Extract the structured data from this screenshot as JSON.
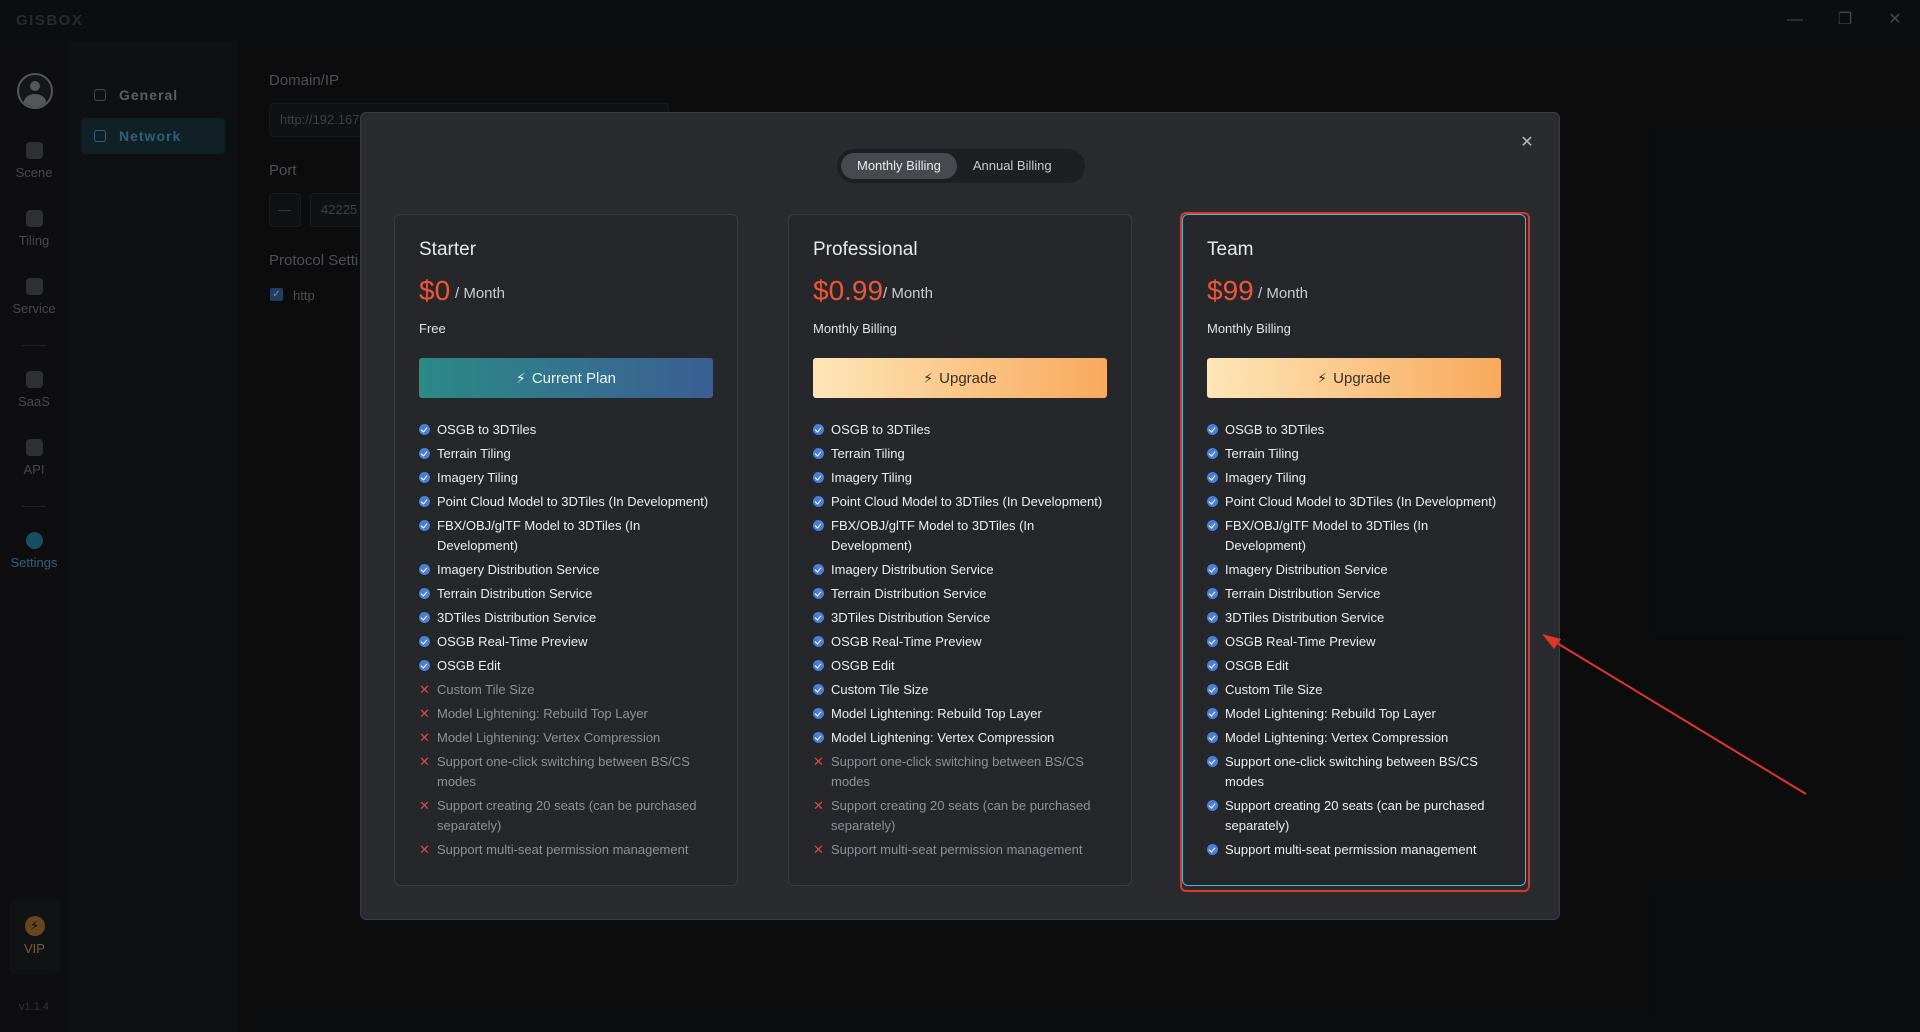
{
  "app": {
    "logo": "GISBOX",
    "version": "v1.1.4"
  },
  "window": {
    "min": "—",
    "restore": "❐",
    "close": "✕"
  },
  "rail": {
    "items": [
      {
        "label": "Scene",
        "icon": "scene-icon"
      },
      {
        "label": "Tiling",
        "icon": "tiling-icon"
      },
      {
        "label": "Service",
        "icon": "service-icon"
      },
      {
        "label": "SaaS",
        "icon": "saas-icon"
      },
      {
        "label": "API",
        "icon": "api-icon"
      },
      {
        "label": "Settings",
        "icon": "settings-icon"
      }
    ],
    "vip": {
      "label": "VIP",
      "icon": "⚡"
    }
  },
  "submenu": {
    "items": [
      {
        "label": "General"
      },
      {
        "label": "Network"
      }
    ]
  },
  "form": {
    "domain_label": "Domain/IP",
    "domain_value": "http://192.167.",
    "port_label": "Port",
    "port_minus": "—",
    "port_value": "42225",
    "protocol_label": "Protocol Setti",
    "protocol_option": "http"
  },
  "dialog": {
    "close": "✕",
    "billing_options": [
      "Monthly Billing",
      "Annual Billing"
    ],
    "plans": [
      {
        "name": "Starter",
        "price": "$0",
        "period": "/ Month",
        "billing": "Free",
        "button": "Current Plan",
        "features": [
          {
            "text": "OSGB to 3DTiles",
            "included": true
          },
          {
            "text": "Terrain Tiling",
            "included": true
          },
          {
            "text": "Imagery Tiling",
            "included": true
          },
          {
            "text": "Point Cloud Model to 3DTiles (In Development)",
            "included": true
          },
          {
            "text": "FBX/OBJ/glTF Model to 3DTiles (In Development)",
            "included": true
          },
          {
            "text": "Imagery Distribution Service",
            "included": true
          },
          {
            "text": "Terrain Distribution Service",
            "included": true
          },
          {
            "text": "3DTiles Distribution Service",
            "included": true
          },
          {
            "text": "OSGB Real-Time Preview",
            "included": true
          },
          {
            "text": "OSGB Edit",
            "included": true
          },
          {
            "text": "Custom Tile Size",
            "included": false
          },
          {
            "text": "Model Lightening: Rebuild Top Layer",
            "included": false
          },
          {
            "text": "Model Lightening: Vertex Compression",
            "included": false
          },
          {
            "text": "Support one-click switching between BS/CS modes",
            "included": false
          },
          {
            "text": "Support creating 20 seats (can be purchased separately)",
            "included": false
          },
          {
            "text": "Support multi-seat permission management",
            "included": false
          }
        ]
      },
      {
        "name": "Professional",
        "price": "$0.99",
        "period": "/ Month",
        "billing": "Monthly Billing",
        "button": "Upgrade",
        "features": [
          {
            "text": "OSGB to 3DTiles",
            "included": true
          },
          {
            "text": "Terrain Tiling",
            "included": true
          },
          {
            "text": "Imagery Tiling",
            "included": true
          },
          {
            "text": "Point Cloud Model to 3DTiles (In Development)",
            "included": true
          },
          {
            "text": "FBX/OBJ/glTF Model to 3DTiles (In Development)",
            "included": true
          },
          {
            "text": "Imagery Distribution Service",
            "included": true
          },
          {
            "text": "Terrain Distribution Service",
            "included": true
          },
          {
            "text": "3DTiles Distribution Service",
            "included": true
          },
          {
            "text": "OSGB Real-Time Preview",
            "included": true
          },
          {
            "text": "OSGB Edit",
            "included": true
          },
          {
            "text": "Custom Tile Size",
            "included": true
          },
          {
            "text": "Model Lightening: Rebuild Top Layer",
            "included": true
          },
          {
            "text": "Model Lightening: Vertex Compression",
            "included": true
          },
          {
            "text": "Support one-click switching between BS/CS modes",
            "included": false
          },
          {
            "text": "Support creating 20 seats (can be purchased separately)",
            "included": false
          },
          {
            "text": "Support multi-seat permission management",
            "included": false
          }
        ]
      },
      {
        "name": "Team",
        "price": "$99",
        "period": "/ Month",
        "billing": "Monthly Billing",
        "button": "Upgrade",
        "features": [
          {
            "text": "OSGB to 3DTiles",
            "included": true
          },
          {
            "text": "Terrain Tiling",
            "included": true
          },
          {
            "text": "Imagery Tiling",
            "included": true
          },
          {
            "text": "Point Cloud Model to 3DTiles (In Development)",
            "included": true
          },
          {
            "text": "FBX/OBJ/glTF Model to 3DTiles (In Development)",
            "included": true
          },
          {
            "text": "Imagery Distribution Service",
            "included": true
          },
          {
            "text": "Terrain Distribution Service",
            "included": true
          },
          {
            "text": "3DTiles Distribution Service",
            "included": true
          },
          {
            "text": "OSGB Real-Time Preview",
            "included": true
          },
          {
            "text": "OSGB Edit",
            "included": true
          },
          {
            "text": "Custom Tile Size",
            "included": true
          },
          {
            "text": "Model Lightening: Rebuild Top Layer",
            "included": true
          },
          {
            "text": "Model Lightening: Vertex Compression",
            "included": true
          },
          {
            "text": "Support one-click switching between BS/CS modes",
            "included": true
          },
          {
            "text": "Support creating 20 seats (can be purchased separately)",
            "included": true
          },
          {
            "text": "Support multi-seat permission management",
            "included": true
          }
        ]
      }
    ]
  },
  "colors": {
    "accent": "#4fb5d6",
    "price": "#f0553a",
    "annotation": "#e0362a"
  }
}
